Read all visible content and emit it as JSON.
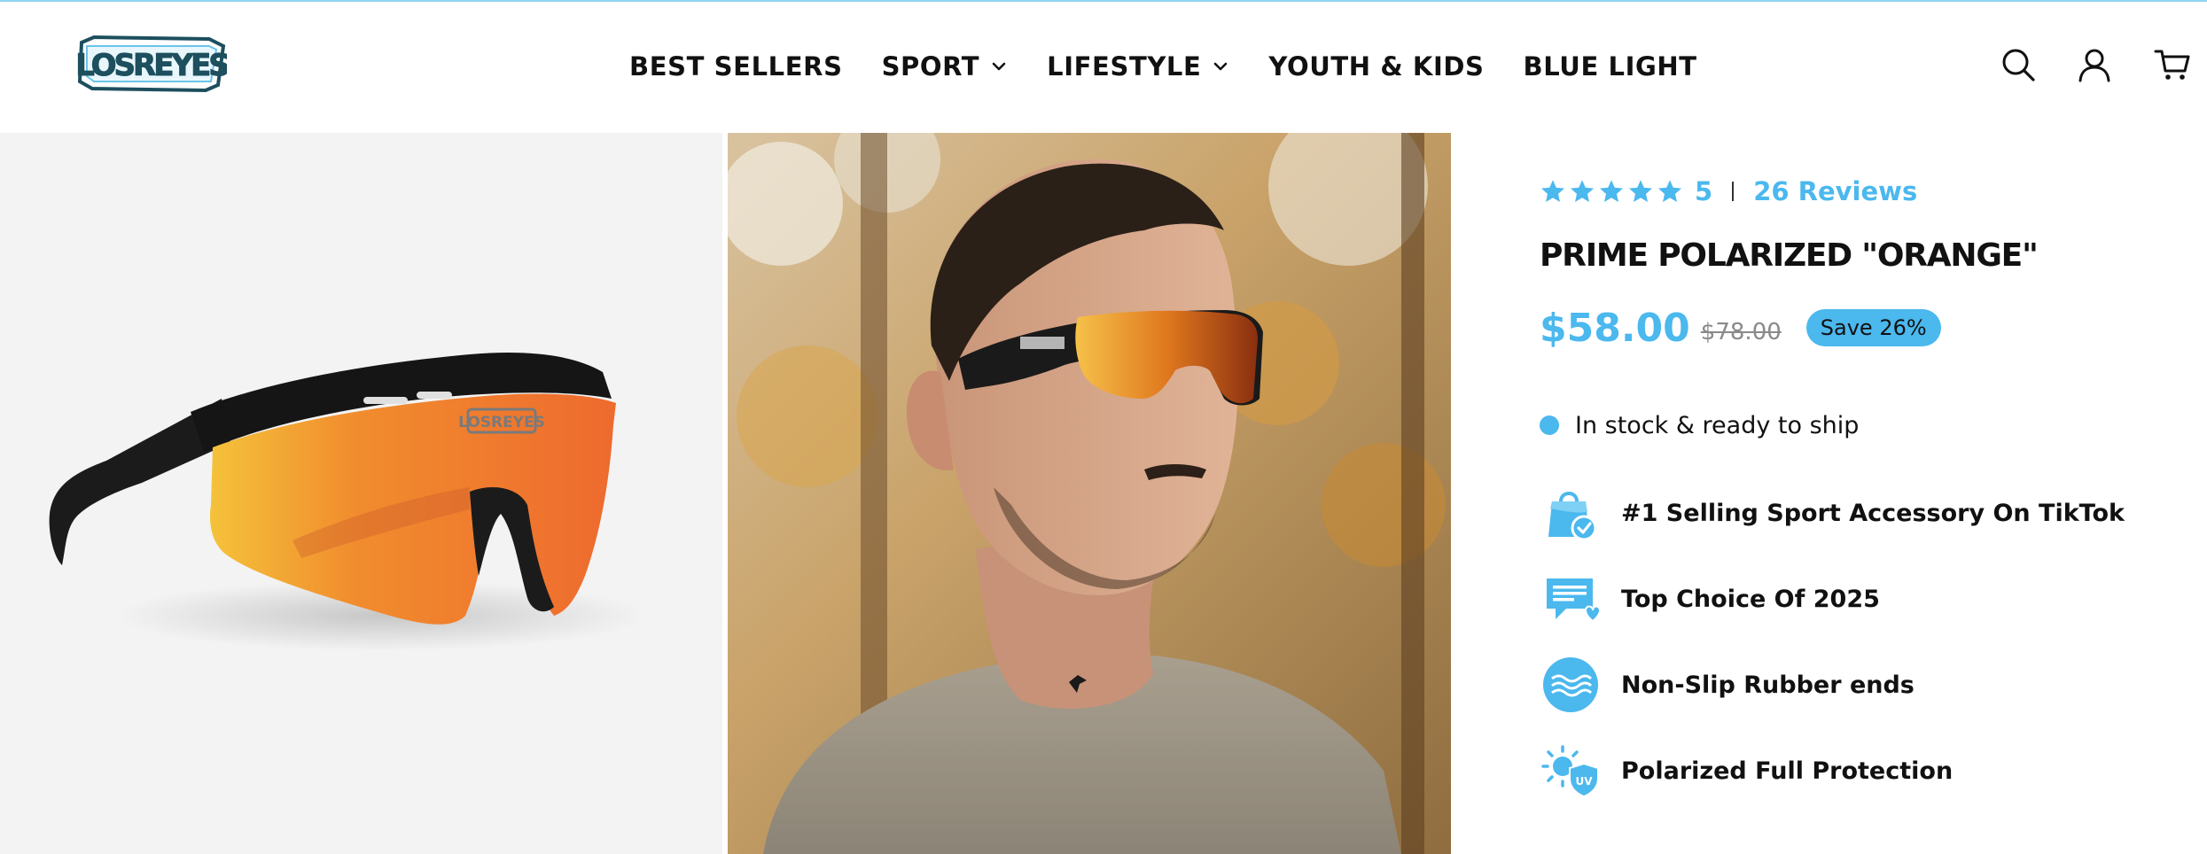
{
  "brand": {
    "logo_text": "LOSREYES"
  },
  "nav": {
    "items": [
      {
        "label": "BEST SELLERS",
        "has_dropdown": false
      },
      {
        "label": "SPORT",
        "has_dropdown": true
      },
      {
        "label": "LIFESTYLE",
        "has_dropdown": true
      },
      {
        "label": "YOUTH & KIDS",
        "has_dropdown": false
      },
      {
        "label": "BLUE LIGHT",
        "has_dropdown": false
      }
    ]
  },
  "header_icons": [
    "search-icon",
    "account-icon",
    "cart-icon"
  ],
  "product": {
    "rating_value": "5",
    "rating_stars": 5,
    "reviews_label": "26 Reviews",
    "title": "PRIME POLARIZED \"ORANGE\"",
    "price": "$58.00",
    "compare_price": "$78.00",
    "save_badge": "Save 26%",
    "stock_text": "In stock & ready to ship",
    "features": [
      {
        "icon": "shopping-bag-check-icon",
        "label": "#1 Selling Sport Accessory On TikTok"
      },
      {
        "icon": "chat-heart-icon",
        "label": "Top Choice Of 2025"
      },
      {
        "icon": "waves-circle-icon",
        "label": "Non-Slip Rubber ends"
      },
      {
        "icon": "sun-uv-shield-icon",
        "label": "Polarized Full Protection"
      }
    ]
  },
  "colors": {
    "accent": "#4bb8ee",
    "text": "#111111",
    "gallery_bg": "#f3f3f3"
  }
}
